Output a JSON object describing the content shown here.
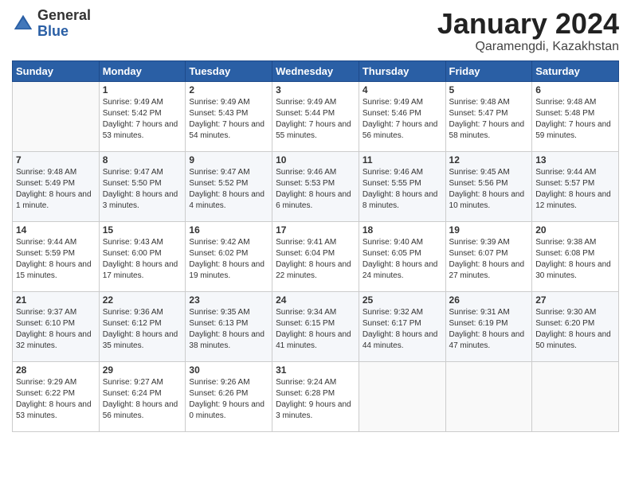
{
  "header": {
    "logo_general": "General",
    "logo_blue": "Blue",
    "title": "January 2024",
    "location": "Qaramengdi, Kazakhstan"
  },
  "weekdays": [
    "Sunday",
    "Monday",
    "Tuesday",
    "Wednesday",
    "Thursday",
    "Friday",
    "Saturday"
  ],
  "weeks": [
    [
      {
        "day": "",
        "sunrise": "",
        "sunset": "",
        "daylight": ""
      },
      {
        "day": "1",
        "sunrise": "Sunrise: 9:49 AM",
        "sunset": "Sunset: 5:42 PM",
        "daylight": "Daylight: 7 hours and 53 minutes."
      },
      {
        "day": "2",
        "sunrise": "Sunrise: 9:49 AM",
        "sunset": "Sunset: 5:43 PM",
        "daylight": "Daylight: 7 hours and 54 minutes."
      },
      {
        "day": "3",
        "sunrise": "Sunrise: 9:49 AM",
        "sunset": "Sunset: 5:44 PM",
        "daylight": "Daylight: 7 hours and 55 minutes."
      },
      {
        "day": "4",
        "sunrise": "Sunrise: 9:49 AM",
        "sunset": "Sunset: 5:46 PM",
        "daylight": "Daylight: 7 hours and 56 minutes."
      },
      {
        "day": "5",
        "sunrise": "Sunrise: 9:48 AM",
        "sunset": "Sunset: 5:47 PM",
        "daylight": "Daylight: 7 hours and 58 minutes."
      },
      {
        "day": "6",
        "sunrise": "Sunrise: 9:48 AM",
        "sunset": "Sunset: 5:48 PM",
        "daylight": "Daylight: 7 hours and 59 minutes."
      }
    ],
    [
      {
        "day": "7",
        "sunrise": "Sunrise: 9:48 AM",
        "sunset": "Sunset: 5:49 PM",
        "daylight": "Daylight: 8 hours and 1 minute."
      },
      {
        "day": "8",
        "sunrise": "Sunrise: 9:47 AM",
        "sunset": "Sunset: 5:50 PM",
        "daylight": "Daylight: 8 hours and 3 minutes."
      },
      {
        "day": "9",
        "sunrise": "Sunrise: 9:47 AM",
        "sunset": "Sunset: 5:52 PM",
        "daylight": "Daylight: 8 hours and 4 minutes."
      },
      {
        "day": "10",
        "sunrise": "Sunrise: 9:46 AM",
        "sunset": "Sunset: 5:53 PM",
        "daylight": "Daylight: 8 hours and 6 minutes."
      },
      {
        "day": "11",
        "sunrise": "Sunrise: 9:46 AM",
        "sunset": "Sunset: 5:55 PM",
        "daylight": "Daylight: 8 hours and 8 minutes."
      },
      {
        "day": "12",
        "sunrise": "Sunrise: 9:45 AM",
        "sunset": "Sunset: 5:56 PM",
        "daylight": "Daylight: 8 hours and 10 minutes."
      },
      {
        "day": "13",
        "sunrise": "Sunrise: 9:44 AM",
        "sunset": "Sunset: 5:57 PM",
        "daylight": "Daylight: 8 hours and 12 minutes."
      }
    ],
    [
      {
        "day": "14",
        "sunrise": "Sunrise: 9:44 AM",
        "sunset": "Sunset: 5:59 PM",
        "daylight": "Daylight: 8 hours and 15 minutes."
      },
      {
        "day": "15",
        "sunrise": "Sunrise: 9:43 AM",
        "sunset": "Sunset: 6:00 PM",
        "daylight": "Daylight: 8 hours and 17 minutes."
      },
      {
        "day": "16",
        "sunrise": "Sunrise: 9:42 AM",
        "sunset": "Sunset: 6:02 PM",
        "daylight": "Daylight: 8 hours and 19 minutes."
      },
      {
        "day": "17",
        "sunrise": "Sunrise: 9:41 AM",
        "sunset": "Sunset: 6:04 PM",
        "daylight": "Daylight: 8 hours and 22 minutes."
      },
      {
        "day": "18",
        "sunrise": "Sunrise: 9:40 AM",
        "sunset": "Sunset: 6:05 PM",
        "daylight": "Daylight: 8 hours and 24 minutes."
      },
      {
        "day": "19",
        "sunrise": "Sunrise: 9:39 AM",
        "sunset": "Sunset: 6:07 PM",
        "daylight": "Daylight: 8 hours and 27 minutes."
      },
      {
        "day": "20",
        "sunrise": "Sunrise: 9:38 AM",
        "sunset": "Sunset: 6:08 PM",
        "daylight": "Daylight: 8 hours and 30 minutes."
      }
    ],
    [
      {
        "day": "21",
        "sunrise": "Sunrise: 9:37 AM",
        "sunset": "Sunset: 6:10 PM",
        "daylight": "Daylight: 8 hours and 32 minutes."
      },
      {
        "day": "22",
        "sunrise": "Sunrise: 9:36 AM",
        "sunset": "Sunset: 6:12 PM",
        "daylight": "Daylight: 8 hours and 35 minutes."
      },
      {
        "day": "23",
        "sunrise": "Sunrise: 9:35 AM",
        "sunset": "Sunset: 6:13 PM",
        "daylight": "Daylight: 8 hours and 38 minutes."
      },
      {
        "day": "24",
        "sunrise": "Sunrise: 9:34 AM",
        "sunset": "Sunset: 6:15 PM",
        "daylight": "Daylight: 8 hours and 41 minutes."
      },
      {
        "day": "25",
        "sunrise": "Sunrise: 9:32 AM",
        "sunset": "Sunset: 6:17 PM",
        "daylight": "Daylight: 8 hours and 44 minutes."
      },
      {
        "day": "26",
        "sunrise": "Sunrise: 9:31 AM",
        "sunset": "Sunset: 6:19 PM",
        "daylight": "Daylight: 8 hours and 47 minutes."
      },
      {
        "day": "27",
        "sunrise": "Sunrise: 9:30 AM",
        "sunset": "Sunset: 6:20 PM",
        "daylight": "Daylight: 8 hours and 50 minutes."
      }
    ],
    [
      {
        "day": "28",
        "sunrise": "Sunrise: 9:29 AM",
        "sunset": "Sunset: 6:22 PM",
        "daylight": "Daylight: 8 hours and 53 minutes."
      },
      {
        "day": "29",
        "sunrise": "Sunrise: 9:27 AM",
        "sunset": "Sunset: 6:24 PM",
        "daylight": "Daylight: 8 hours and 56 minutes."
      },
      {
        "day": "30",
        "sunrise": "Sunrise: 9:26 AM",
        "sunset": "Sunset: 6:26 PM",
        "daylight": "Daylight: 9 hours and 0 minutes."
      },
      {
        "day": "31",
        "sunrise": "Sunrise: 9:24 AM",
        "sunset": "Sunset: 6:28 PM",
        "daylight": "Daylight: 9 hours and 3 minutes."
      },
      {
        "day": "",
        "sunrise": "",
        "sunset": "",
        "daylight": ""
      },
      {
        "day": "",
        "sunrise": "",
        "sunset": "",
        "daylight": ""
      },
      {
        "day": "",
        "sunrise": "",
        "sunset": "",
        "daylight": ""
      }
    ]
  ]
}
